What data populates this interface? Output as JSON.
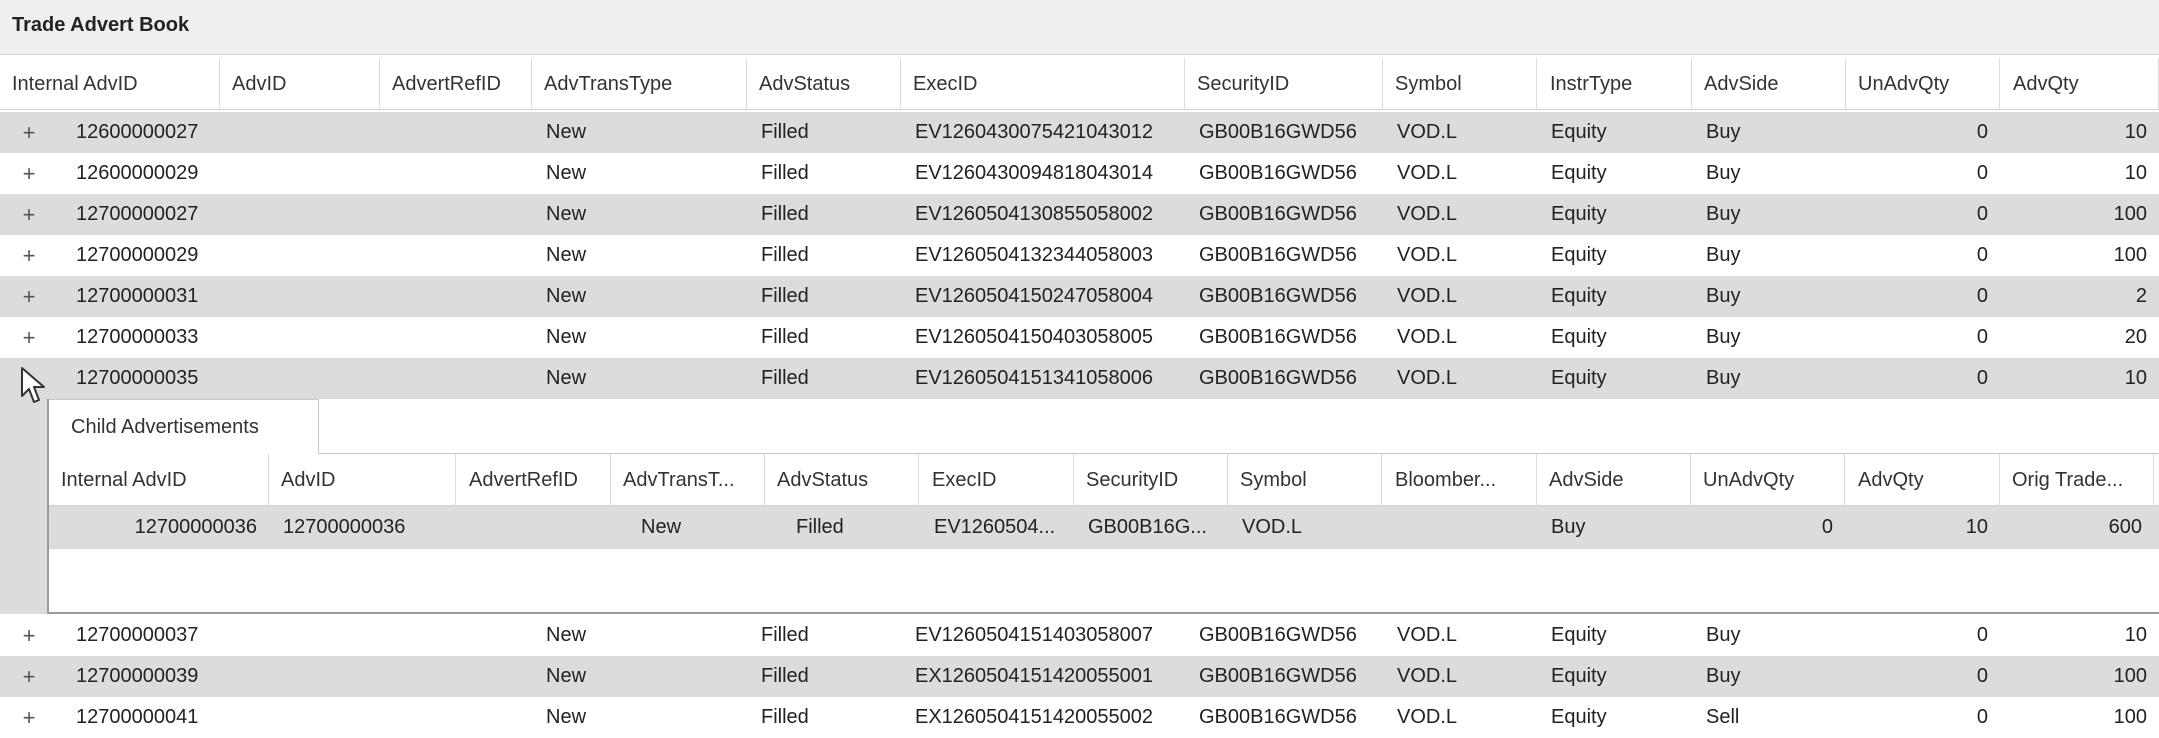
{
  "window": {
    "title": "Trade Advert Book"
  },
  "grid": {
    "columns": [
      "Internal AdvID",
      "AdvID",
      "AdvertRefID",
      "AdvTransType",
      "AdvStatus",
      "ExecID",
      "SecurityID",
      "Symbol",
      "InstrType",
      "AdvSide",
      "UnAdvQty",
      "AdvQty"
    ],
    "rows_top": [
      {
        "expander": "+",
        "internal": "12600000027",
        "advid": "",
        "ref": "",
        "trans": "New",
        "status": "Filled",
        "exec": "EV1260430075421043012",
        "sec": "GB00B16GWD56",
        "sym": "VOD.L",
        "instr": "Equity",
        "side": "Buy",
        "unadv": "0",
        "qty": "10"
      },
      {
        "expander": "+",
        "internal": "12600000029",
        "advid": "",
        "ref": "",
        "trans": "New",
        "status": "Filled",
        "exec": "EV1260430094818043014",
        "sec": "GB00B16GWD56",
        "sym": "VOD.L",
        "instr": "Equity",
        "side": "Buy",
        "unadv": "0",
        "qty": "10"
      },
      {
        "expander": "+",
        "internal": "12700000027",
        "advid": "",
        "ref": "",
        "trans": "New",
        "status": "Filled",
        "exec": "EV1260504130855058002",
        "sec": "GB00B16GWD56",
        "sym": "VOD.L",
        "instr": "Equity",
        "side": "Buy",
        "unadv": "0",
        "qty": "100"
      },
      {
        "expander": "+",
        "internal": "12700000029",
        "advid": "",
        "ref": "",
        "trans": "New",
        "status": "Filled",
        "exec": "EV1260504132344058003",
        "sec": "GB00B16GWD56",
        "sym": "VOD.L",
        "instr": "Equity",
        "side": "Buy",
        "unadv": "0",
        "qty": "100"
      },
      {
        "expander": "+",
        "internal": "12700000031",
        "advid": "",
        "ref": "",
        "trans": "New",
        "status": "Filled",
        "exec": "EV1260504150247058004",
        "sec": "GB00B16GWD56",
        "sym": "VOD.L",
        "instr": "Equity",
        "side": "Buy",
        "unadv": "0",
        "qty": "2"
      },
      {
        "expander": "+",
        "internal": "12700000033",
        "advid": "",
        "ref": "",
        "trans": "New",
        "status": "Filled",
        "exec": "EV1260504150403058005",
        "sec": "GB00B16GWD56",
        "sym": "VOD.L",
        "instr": "Equity",
        "side": "Buy",
        "unadv": "0",
        "qty": "20"
      },
      {
        "expander": "-",
        "internal": "12700000035",
        "advid": "",
        "ref": "",
        "trans": "New",
        "status": "Filled",
        "exec": "EV1260504151341058006",
        "sec": "GB00B16GWD56",
        "sym": "VOD.L",
        "instr": "Equity",
        "side": "Buy",
        "unadv": "0",
        "qty": "10"
      }
    ],
    "rows_bottom": [
      {
        "expander": "+",
        "internal": "12700000037",
        "advid": "",
        "ref": "",
        "trans": "New",
        "status": "Filled",
        "exec": "EV1260504151403058007",
        "sec": "GB00B16GWD56",
        "sym": "VOD.L",
        "instr": "Equity",
        "side": "Buy",
        "unadv": "0",
        "qty": "10"
      },
      {
        "expander": "+",
        "internal": "12700000039",
        "advid": "",
        "ref": "",
        "trans": "New",
        "status": "Filled",
        "exec": "EX1260504151420055001",
        "sec": "GB00B16GWD56",
        "sym": "VOD.L",
        "instr": "Equity",
        "side": "Buy",
        "unadv": "0",
        "qty": "100"
      },
      {
        "expander": "+",
        "internal": "12700000041",
        "advid": "",
        "ref": "",
        "trans": "New",
        "status": "Filled",
        "exec": "EX1260504151420055002",
        "sec": "GB00B16GWD56",
        "sym": "VOD.L",
        "instr": "Equity",
        "side": "Sell",
        "unadv": "0",
        "qty": "100"
      }
    ]
  },
  "child": {
    "tab_label": "Child Advertisements",
    "columns": [
      "Internal AdvID",
      "AdvID",
      "AdvertRefID",
      "AdvTransT...",
      "AdvStatus",
      "ExecID",
      "SecurityID",
      "Symbol",
      "Bloomber...",
      "AdvSide",
      "UnAdvQty",
      "AdvQty",
      "Orig Trade..."
    ],
    "row": {
      "internal": "12700000036",
      "advid": "12700000036",
      "ref": "",
      "trans": "New",
      "status": "Filled",
      "exec": "EV1260504...",
      "sec": "GB00B16G...",
      "sym": "VOD.L",
      "bloom": "",
      "side": "Buy",
      "unadv": "0",
      "qty": "10",
      "orig": "600"
    }
  },
  "icons": {
    "cursor": "mouse-pointer-icon",
    "expand": "plus-icon"
  }
}
